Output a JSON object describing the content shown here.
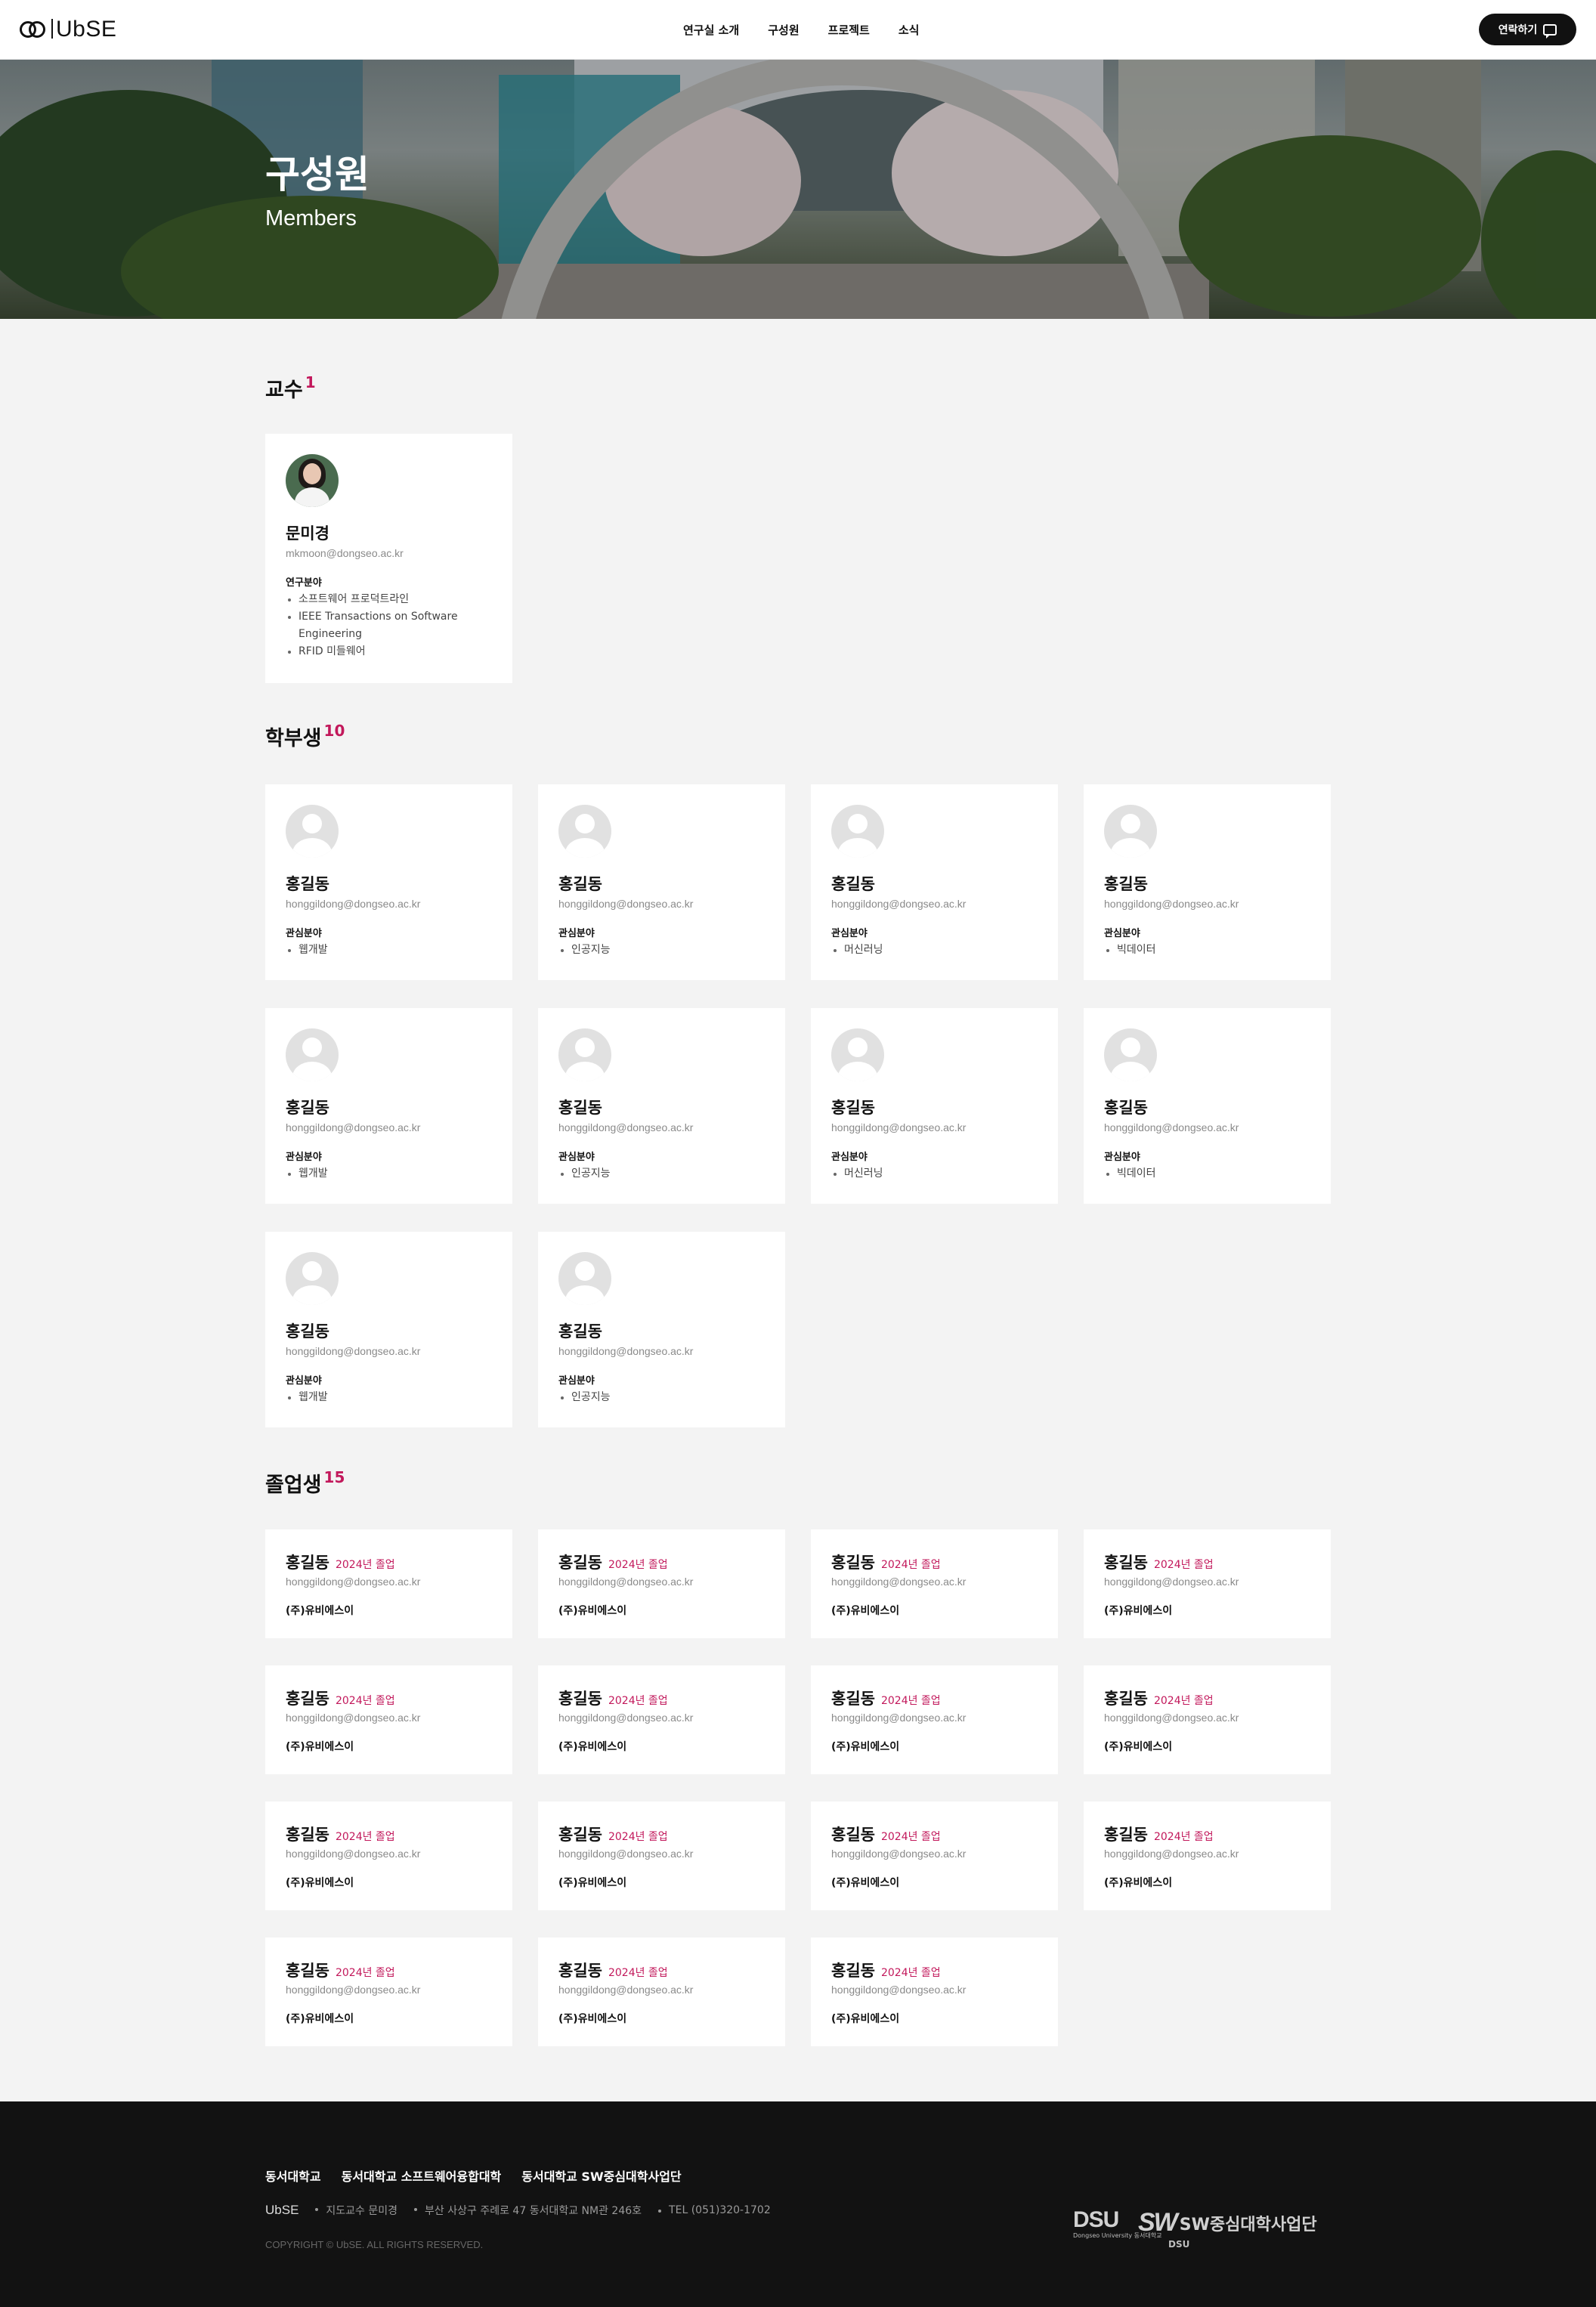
{
  "header": {
    "logo_text": "UbSE",
    "nav": [
      "연구실 소개",
      "구성원",
      "프로젝트",
      "소식"
    ],
    "contact_label": "연락하기"
  },
  "hero": {
    "title": "구성원",
    "subtitle": "Members"
  },
  "professor_section": {
    "title": "교수",
    "count": "1",
    "card": {
      "name": "문미경",
      "email": "mkmoon@dongseo.ac.kr",
      "label": "연구분야",
      "items": [
        "소프트웨어 프로덕트라인",
        "IEEE Transactions on Software Engineering",
        "RFID 미들웨어"
      ]
    }
  },
  "undergrad_section": {
    "title": "학부생",
    "count": "10",
    "label": "관심분야",
    "members": [
      {
        "name": "홍길동",
        "email": "honggildong@dongseo.ac.kr",
        "interest": "웹개발"
      },
      {
        "name": "홍길동",
        "email": "honggildong@dongseo.ac.kr",
        "interest": "인공지능"
      },
      {
        "name": "홍길동",
        "email": "honggildong@dongseo.ac.kr",
        "interest": "머신러닝"
      },
      {
        "name": "홍길동",
        "email": "honggildong@dongseo.ac.kr",
        "interest": "빅데이터"
      },
      {
        "name": "홍길동",
        "email": "honggildong@dongseo.ac.kr",
        "interest": "웹개발"
      },
      {
        "name": "홍길동",
        "email": "honggildong@dongseo.ac.kr",
        "interest": "인공지능"
      },
      {
        "name": "홍길동",
        "email": "honggildong@dongseo.ac.kr",
        "interest": "머신러닝"
      },
      {
        "name": "홍길동",
        "email": "honggildong@dongseo.ac.kr",
        "interest": "빅데이터"
      },
      {
        "name": "홍길동",
        "email": "honggildong@dongseo.ac.kr",
        "interest": "웹개발"
      },
      {
        "name": "홍길동",
        "email": "honggildong@dongseo.ac.kr",
        "interest": "인공지능"
      }
    ]
  },
  "graduate_section": {
    "title": "졸업생",
    "count": "15",
    "members": [
      {
        "name": "홍길동",
        "year": "2024년 졸업",
        "email": "honggildong@dongseo.ac.kr",
        "company": "(주)유비에스이"
      },
      {
        "name": "홍길동",
        "year": "2024년 졸업",
        "email": "honggildong@dongseo.ac.kr",
        "company": "(주)유비에스이"
      },
      {
        "name": "홍길동",
        "year": "2024년 졸업",
        "email": "honggildong@dongseo.ac.kr",
        "company": "(주)유비에스이"
      },
      {
        "name": "홍길동",
        "year": "2024년 졸업",
        "email": "honggildong@dongseo.ac.kr",
        "company": "(주)유비에스이"
      },
      {
        "name": "홍길동",
        "year": "2024년 졸업",
        "email": "honggildong@dongseo.ac.kr",
        "company": "(주)유비에스이"
      },
      {
        "name": "홍길동",
        "year": "2024년 졸업",
        "email": "honggildong@dongseo.ac.kr",
        "company": "(주)유비에스이"
      },
      {
        "name": "홍길동",
        "year": "2024년 졸업",
        "email": "honggildong@dongseo.ac.kr",
        "company": "(주)유비에스이"
      },
      {
        "name": "홍길동",
        "year": "2024년 졸업",
        "email": "honggildong@dongseo.ac.kr",
        "company": "(주)유비에스이"
      },
      {
        "name": "홍길동",
        "year": "2024년 졸업",
        "email": "honggildong@dongseo.ac.kr",
        "company": "(주)유비에스이"
      },
      {
        "name": "홍길동",
        "year": "2024년 졸업",
        "email": "honggildong@dongseo.ac.kr",
        "company": "(주)유비에스이"
      },
      {
        "name": "홍길동",
        "year": "2024년 졸업",
        "email": "honggildong@dongseo.ac.kr",
        "company": "(주)유비에스이"
      },
      {
        "name": "홍길동",
        "year": "2024년 졸업",
        "email": "honggildong@dongseo.ac.kr",
        "company": "(주)유비에스이"
      },
      {
        "name": "홍길동",
        "year": "2024년 졸업",
        "email": "honggildong@dongseo.ac.kr",
        "company": "(주)유비에스이"
      },
      {
        "name": "홍길동",
        "year": "2024년 졸업",
        "email": "honggildong@dongseo.ac.kr",
        "company": "(주)유비에스이"
      },
      {
        "name": "홍길동",
        "year": "2024년 졸업",
        "email": "honggildong@dongseo.ac.kr",
        "company": "(주)유비에스이"
      }
    ]
  },
  "footer": {
    "links": [
      "동서대학교",
      "동서대학교 소프트웨어융합대학",
      "동서대학교 SW중심대학사업단"
    ],
    "brand": "UbSE",
    "advisor": "지도교수 문미경",
    "address": "부산 사상구 주례로 47 동서대학교 NM관 246호",
    "tel": "TEL (051)320-1702",
    "copyright": "COPYRIGHT © UbSE. ALL RIGHTS RESERVED.",
    "dsu_logo": "DSU",
    "dsu_sub": "Dongseo University 동서대학교",
    "sw_mark": "SW",
    "sw_text": "SW중심대학사업단",
    "sw_sub": "DSU"
  },
  "colors": {
    "accent": "#c2185b",
    "header_bg": "#ffffff",
    "footer_bg": "#121212",
    "page_bg": "#f3f3f3"
  }
}
